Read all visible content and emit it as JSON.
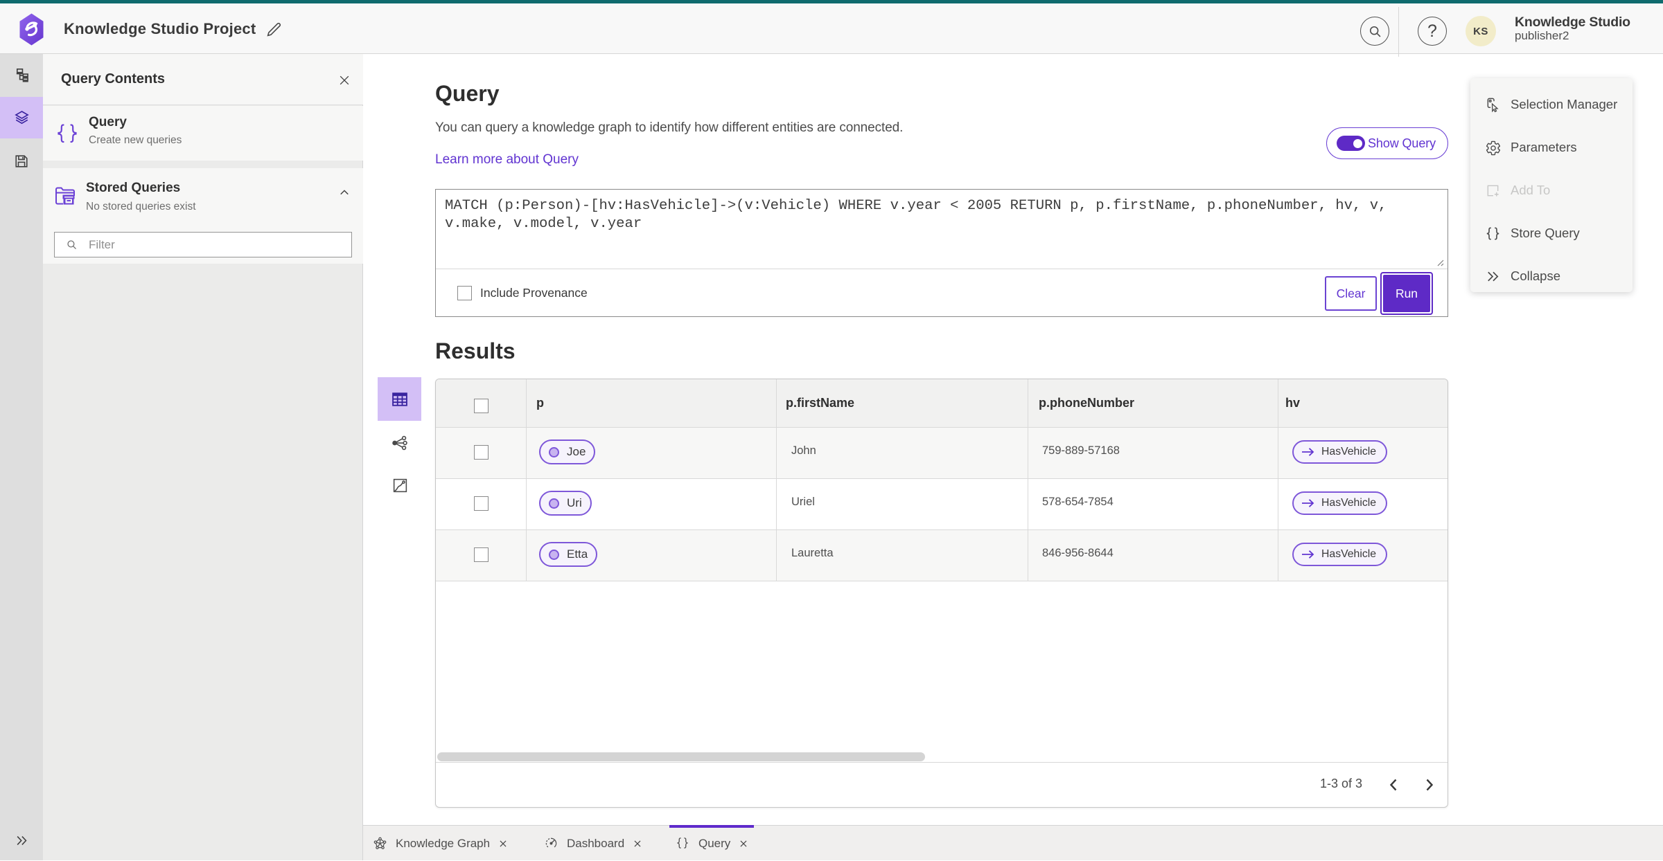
{
  "header": {
    "app_title": "Knowledge Studio Project",
    "help_glyph": "?",
    "user": {
      "initials": "KS",
      "org": "Knowledge Studio",
      "username": "publisher2"
    }
  },
  "panel": {
    "title": "Query Contents",
    "query_item": {
      "title": "Query",
      "subtitle": "Create new queries",
      "icon_glyph": "{}"
    },
    "stored": {
      "title": "Stored Queries",
      "subtitle": "No stored queries exist"
    },
    "filter_placeholder": "Filter"
  },
  "main": {
    "title": "Query",
    "description": "You can query a knowledge graph to identify how different entities are connected.",
    "learn_link": "Learn more about Query",
    "show_query_label": "Show Query",
    "query_text": "MATCH (p:Person)-[hv:HasVehicle]->(v:Vehicle) WHERE v.year < 2005 RETURN p, p.firstName, p.phoneNumber, hv, v,\nv.make, v.model, v.year",
    "include_provenance_label": "Include Provenance",
    "clear_label": "Clear",
    "run_label": "Run",
    "results_title": "Results"
  },
  "results": {
    "columns": {
      "p": "p",
      "first_name": "p.firstName",
      "phone": "p.phoneNumber",
      "hv": "hv"
    },
    "rows": [
      {
        "p": "Joe",
        "first_name": "John",
        "phone": "759-889-57168",
        "hv": "HasVehicle"
      },
      {
        "p": "Uri",
        "first_name": "Uriel",
        "phone": "578-654-7854",
        "hv": "HasVehicle"
      },
      {
        "p": "Etta",
        "first_name": "Lauretta",
        "phone": "846-956-8644",
        "hv": "HasVehicle"
      }
    ],
    "pagination": {
      "label": "1-3 of 3"
    }
  },
  "tools": {
    "items": [
      {
        "label": "Selection Manager"
      },
      {
        "label": "Parameters"
      },
      {
        "label": "Add To"
      },
      {
        "label": "Store Query",
        "icon_glyph": "{ }"
      },
      {
        "label": "Collapse"
      }
    ]
  },
  "tabs": [
    {
      "label": "Knowledge Graph"
    },
    {
      "label": "Dashboard"
    },
    {
      "label": "Query",
      "icon_glyph": "{ }"
    }
  ],
  "colors": {
    "accent_purple": "#5e2ac6",
    "light_purple_bg": "#d3bff6",
    "teal_strip": "#0f6b6e",
    "pill_border": "#7e57d9"
  }
}
